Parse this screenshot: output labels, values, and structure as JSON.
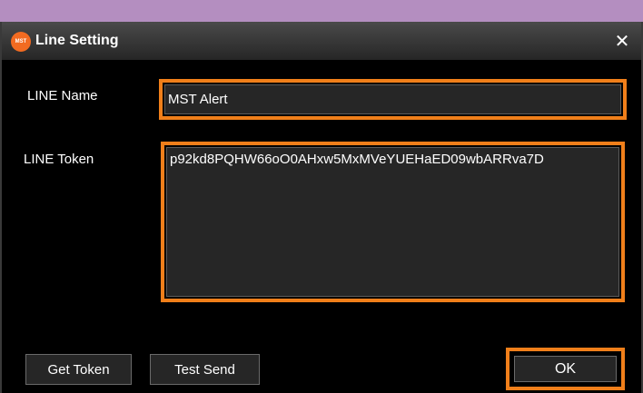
{
  "window": {
    "title": "Line Setting",
    "app_icon_text": "MST",
    "close_glyph": "✕"
  },
  "form": {
    "name_label": "LINE Name",
    "name_value": "MST Alert",
    "token_label": "LINE Token",
    "token_value": "p92kd8PQHW66oO0AHxw5MxMVeYUEHaED09wbARRva7D"
  },
  "buttons": {
    "get_token": "Get Token",
    "test_send": "Test Send",
    "ok": "OK"
  },
  "colors": {
    "highlight": "#f07f1a",
    "background": "#000000",
    "desktop": "#b48ec0",
    "app_icon": "#f26b21"
  }
}
